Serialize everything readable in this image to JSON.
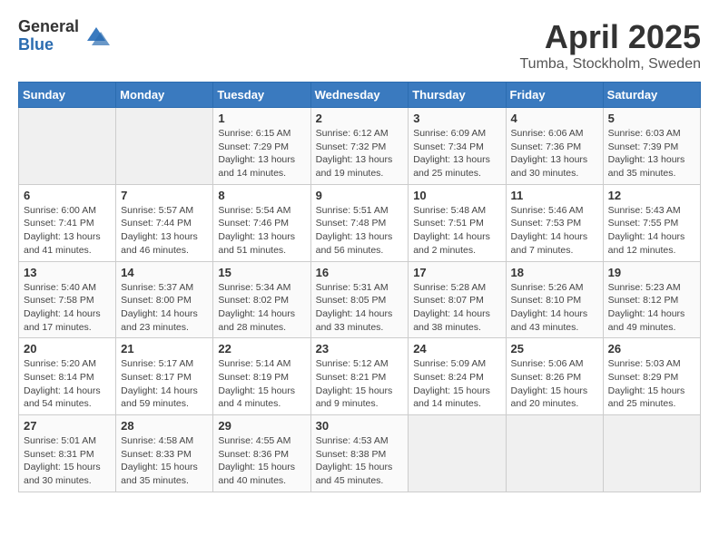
{
  "logo": {
    "general": "General",
    "blue": "Blue"
  },
  "title": "April 2025",
  "location": "Tumba, Stockholm, Sweden",
  "days_of_week": [
    "Sunday",
    "Monday",
    "Tuesday",
    "Wednesday",
    "Thursday",
    "Friday",
    "Saturday"
  ],
  "weeks": [
    [
      {
        "day": "",
        "empty": true
      },
      {
        "day": "",
        "empty": true
      },
      {
        "day": "1",
        "sunrise": "Sunrise: 6:15 AM",
        "sunset": "Sunset: 7:29 PM",
        "daylight": "Daylight: 13 hours and 14 minutes."
      },
      {
        "day": "2",
        "sunrise": "Sunrise: 6:12 AM",
        "sunset": "Sunset: 7:32 PM",
        "daylight": "Daylight: 13 hours and 19 minutes."
      },
      {
        "day": "3",
        "sunrise": "Sunrise: 6:09 AM",
        "sunset": "Sunset: 7:34 PM",
        "daylight": "Daylight: 13 hours and 25 minutes."
      },
      {
        "day": "4",
        "sunrise": "Sunrise: 6:06 AM",
        "sunset": "Sunset: 7:36 PM",
        "daylight": "Daylight: 13 hours and 30 minutes."
      },
      {
        "day": "5",
        "sunrise": "Sunrise: 6:03 AM",
        "sunset": "Sunset: 7:39 PM",
        "daylight": "Daylight: 13 hours and 35 minutes."
      }
    ],
    [
      {
        "day": "6",
        "sunrise": "Sunrise: 6:00 AM",
        "sunset": "Sunset: 7:41 PM",
        "daylight": "Daylight: 13 hours and 41 minutes."
      },
      {
        "day": "7",
        "sunrise": "Sunrise: 5:57 AM",
        "sunset": "Sunset: 7:44 PM",
        "daylight": "Daylight: 13 hours and 46 minutes."
      },
      {
        "day": "8",
        "sunrise": "Sunrise: 5:54 AM",
        "sunset": "Sunset: 7:46 PM",
        "daylight": "Daylight: 13 hours and 51 minutes."
      },
      {
        "day": "9",
        "sunrise": "Sunrise: 5:51 AM",
        "sunset": "Sunset: 7:48 PM",
        "daylight": "Daylight: 13 hours and 56 minutes."
      },
      {
        "day": "10",
        "sunrise": "Sunrise: 5:48 AM",
        "sunset": "Sunset: 7:51 PM",
        "daylight": "Daylight: 14 hours and 2 minutes."
      },
      {
        "day": "11",
        "sunrise": "Sunrise: 5:46 AM",
        "sunset": "Sunset: 7:53 PM",
        "daylight": "Daylight: 14 hours and 7 minutes."
      },
      {
        "day": "12",
        "sunrise": "Sunrise: 5:43 AM",
        "sunset": "Sunset: 7:55 PM",
        "daylight": "Daylight: 14 hours and 12 minutes."
      }
    ],
    [
      {
        "day": "13",
        "sunrise": "Sunrise: 5:40 AM",
        "sunset": "Sunset: 7:58 PM",
        "daylight": "Daylight: 14 hours and 17 minutes."
      },
      {
        "day": "14",
        "sunrise": "Sunrise: 5:37 AM",
        "sunset": "Sunset: 8:00 PM",
        "daylight": "Daylight: 14 hours and 23 minutes."
      },
      {
        "day": "15",
        "sunrise": "Sunrise: 5:34 AM",
        "sunset": "Sunset: 8:02 PM",
        "daylight": "Daylight: 14 hours and 28 minutes."
      },
      {
        "day": "16",
        "sunrise": "Sunrise: 5:31 AM",
        "sunset": "Sunset: 8:05 PM",
        "daylight": "Daylight: 14 hours and 33 minutes."
      },
      {
        "day": "17",
        "sunrise": "Sunrise: 5:28 AM",
        "sunset": "Sunset: 8:07 PM",
        "daylight": "Daylight: 14 hours and 38 minutes."
      },
      {
        "day": "18",
        "sunrise": "Sunrise: 5:26 AM",
        "sunset": "Sunset: 8:10 PM",
        "daylight": "Daylight: 14 hours and 43 minutes."
      },
      {
        "day": "19",
        "sunrise": "Sunrise: 5:23 AM",
        "sunset": "Sunset: 8:12 PM",
        "daylight": "Daylight: 14 hours and 49 minutes."
      }
    ],
    [
      {
        "day": "20",
        "sunrise": "Sunrise: 5:20 AM",
        "sunset": "Sunset: 8:14 PM",
        "daylight": "Daylight: 14 hours and 54 minutes."
      },
      {
        "day": "21",
        "sunrise": "Sunrise: 5:17 AM",
        "sunset": "Sunset: 8:17 PM",
        "daylight": "Daylight: 14 hours and 59 minutes."
      },
      {
        "day": "22",
        "sunrise": "Sunrise: 5:14 AM",
        "sunset": "Sunset: 8:19 PM",
        "daylight": "Daylight: 15 hours and 4 minutes."
      },
      {
        "day": "23",
        "sunrise": "Sunrise: 5:12 AM",
        "sunset": "Sunset: 8:21 PM",
        "daylight": "Daylight: 15 hours and 9 minutes."
      },
      {
        "day": "24",
        "sunrise": "Sunrise: 5:09 AM",
        "sunset": "Sunset: 8:24 PM",
        "daylight": "Daylight: 15 hours and 14 minutes."
      },
      {
        "day": "25",
        "sunrise": "Sunrise: 5:06 AM",
        "sunset": "Sunset: 8:26 PM",
        "daylight": "Daylight: 15 hours and 20 minutes."
      },
      {
        "day": "26",
        "sunrise": "Sunrise: 5:03 AM",
        "sunset": "Sunset: 8:29 PM",
        "daylight": "Daylight: 15 hours and 25 minutes."
      }
    ],
    [
      {
        "day": "27",
        "sunrise": "Sunrise: 5:01 AM",
        "sunset": "Sunset: 8:31 PM",
        "daylight": "Daylight: 15 hours and 30 minutes."
      },
      {
        "day": "28",
        "sunrise": "Sunrise: 4:58 AM",
        "sunset": "Sunset: 8:33 PM",
        "daylight": "Daylight: 15 hours and 35 minutes."
      },
      {
        "day": "29",
        "sunrise": "Sunrise: 4:55 AM",
        "sunset": "Sunset: 8:36 PM",
        "daylight": "Daylight: 15 hours and 40 minutes."
      },
      {
        "day": "30",
        "sunrise": "Sunrise: 4:53 AM",
        "sunset": "Sunset: 8:38 PM",
        "daylight": "Daylight: 15 hours and 45 minutes."
      },
      {
        "day": "",
        "empty": true
      },
      {
        "day": "",
        "empty": true
      },
      {
        "day": "",
        "empty": true
      }
    ]
  ]
}
